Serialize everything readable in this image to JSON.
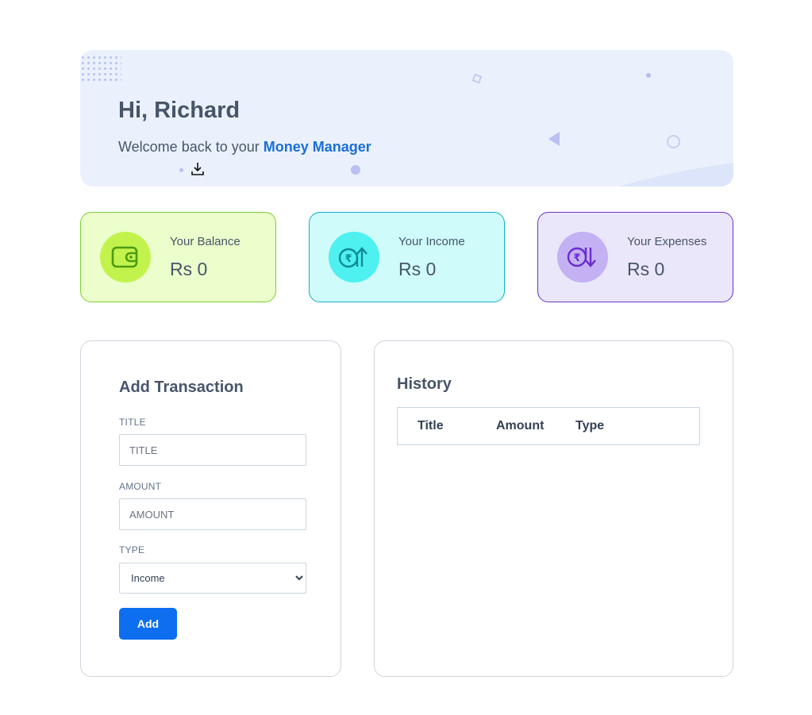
{
  "banner": {
    "greeting": "Hi, Richard",
    "welcome_prefix": "Welcome back to your ",
    "brand": "Money Manager"
  },
  "stats": [
    {
      "label": "Your Balance",
      "value": "Rs 0",
      "icon": "wallet-icon",
      "bg": "#ebfecb",
      "border": "#7bd02f"
    },
    {
      "label": "Your Income",
      "value": "Rs 0",
      "icon": "rupee-income-icon",
      "bg": "#cffcfb",
      "border": "#0fb1c4"
    },
    {
      "label": "Your Expenses",
      "value": "Rs 0",
      "icon": "rupee-expense-icon",
      "bg": "#ebe7fb",
      "border": "#6b33c9"
    }
  ],
  "form": {
    "title": "Add Transaction",
    "title_label": "TITLE",
    "title_placeholder": "TITLE",
    "amount_label": "AMOUNT",
    "amount_placeholder": "AMOUNT",
    "type_label": "TYPE",
    "type_selected": "Income",
    "add_label": "Add"
  },
  "history": {
    "title": "History",
    "columns": [
      "Title",
      "Amount",
      "Type"
    ]
  },
  "colors": {
    "accent": "#1a6ed8",
    "button": "#0e6ef0",
    "banner_bg": "#ebf1fc"
  }
}
